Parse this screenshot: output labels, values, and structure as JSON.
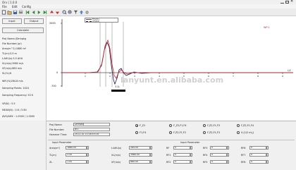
{
  "window": {
    "title": "Orv | 1.0.0"
  },
  "menu": [
    "File",
    "Edit",
    "Config"
  ],
  "left": {
    "input_btn": "Input",
    "output_btn": "Output",
    "calculate_btn": "Calculate",
    "info": [
      "Proj Name:(Dinhpkg",
      "File Number:(pr)",
      "Area(m^2):1880  m²",
      "TL(m):3.5  m",
      "t-AHU(s):3.5  AHU",
      "VL(m/s):3980  m/s",
      "VF(m/s):880  m/s",
      "SL(%):6",
      "WR:(%)284.8  m/s",
      "Sampling Points: 1024",
      "Sampling Frequency: 50 K",
      "VR(N)    : 5.5",
      "MEAN(N)  : 0.6 / 5.80",
      "AVG/AMX  : 1.0000 / 1.0000"
    ]
  },
  "chart": {
    "legend": [
      "F(t)(Z1)",
      "V(t)(Z1)"
    ],
    "y_top": "2000",
    "y_mid": "0",
    "y_bottom": "-700",
    "x_unit": "L/C",
    "marker": "WP:1",
    "window_label": "3.1L",
    "x_ticks": [
      "1",
      "2",
      "3",
      "4",
      "5",
      "6",
      "7",
      "8",
      "9"
    ],
    "watermark": "lanyunt.en.alibaba.com"
  },
  "form": {
    "proj_name_label": "Proj Name:",
    "proj_name": "Dinhpkg",
    "file_number_label": "File Number:",
    "file_number": "pr1",
    "hammer_time_label": "Hammer Time:",
    "hammer_time": "2012-10-13 08:55:16",
    "radios": [
      "F_Z1",
      "F_Z2,F1,F4",
      "F,Z2,F1,F3",
      "F,Z2,F1,F4",
      "F1,F4",
      "F,Z2,F1,F2",
      "F,Z2,F1,F3",
      "V,(1/2 m),J"
    ],
    "input_section": "Input Parameter",
    "output_section": "Input Parameter",
    "area_label": "Area(m²)",
    "area": "1880.00",
    "tl_label": "TL(m)",
    "tl": "3.50",
    "zl_label": "ZL",
    "zl": "1.00",
    "tahu_label": "t-AHU(s)",
    "tahu": "284.00",
    "vlms_label": "VL(m/s)",
    "vlms": "3980.00",
    "vfms_label": "VF(m/s)",
    "vfms": "880.00",
    "o1_label": "RF",
    "o1": "0",
    "o2_label": "RF1",
    "o2": "0",
    "o3_label": "RF2",
    "o3": "0",
    "o4_label": "RF3",
    "o4": "0",
    "o5_label": "RF4",
    "o5": "0",
    "o6_label": "RF5",
    "o6": "0",
    "o7_label": "RF6",
    "o7": "0",
    "o8_label": "RF7",
    "o8": "0",
    "o9_label": "RF8",
    "o9": "0"
  }
}
